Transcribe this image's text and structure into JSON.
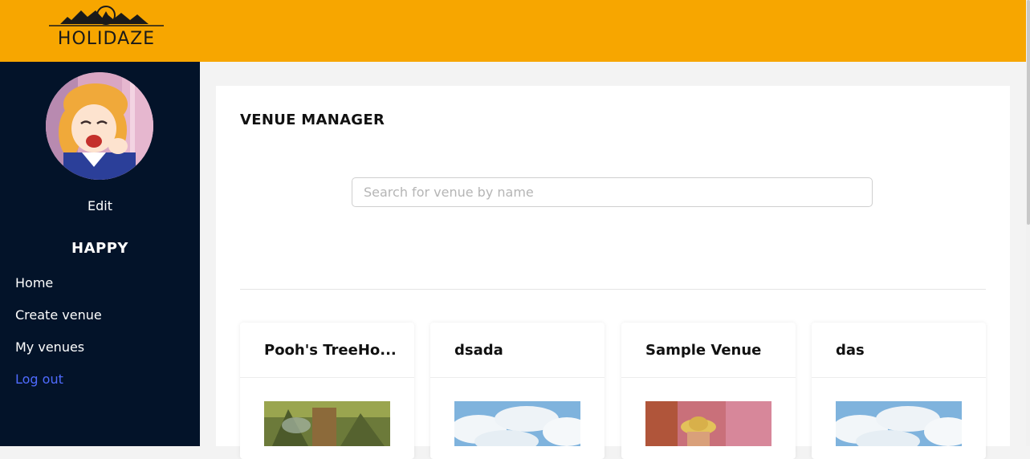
{
  "header": {
    "logo_text": "HOLIDAZE",
    "brand_color": "#f7a600"
  },
  "sidebar": {
    "avatar_alt": "profile-avatar",
    "edit_label": "Edit",
    "username": "HAPPY",
    "nav": [
      {
        "label": "Home"
      },
      {
        "label": "Create venue"
      },
      {
        "label": "My venues"
      },
      {
        "label": "Log out"
      }
    ]
  },
  "main": {
    "title": "VENUE MANAGER",
    "search": {
      "placeholder": "Search for venue by name",
      "value": ""
    },
    "venues": [
      {
        "name": "Pooh's TreeHo...",
        "image": "treehouse-photo"
      },
      {
        "name": "dsada",
        "image": "sky-clouds-photo"
      },
      {
        "name": "Sample Venue",
        "image": "straw-hat-figure-photo"
      },
      {
        "name": "das",
        "image": "sky-clouds-photo"
      }
    ]
  }
}
